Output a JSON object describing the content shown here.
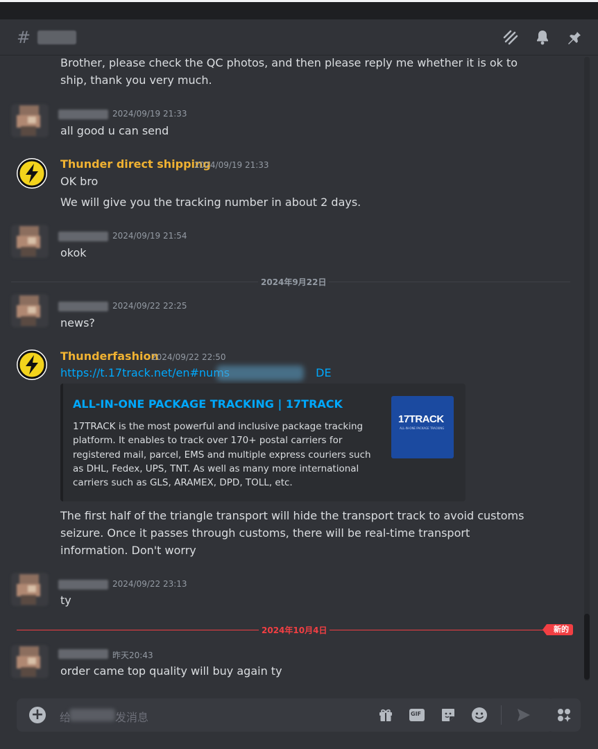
{
  "header": {
    "channel_icon": "hash-icon",
    "icons": [
      "threads-icon",
      "bell-icon",
      "pin-icon"
    ]
  },
  "messages": [
    {
      "text": "Brother, please check the QC photos, and then please reply me whether it is ok to ship, thank you very much."
    },
    {
      "timestamp": "2024/09/19 21:33",
      "text": "all good u can send"
    },
    {
      "username": "Thunder direct shipping",
      "timestamp": "2024/09/19 21:33",
      "lines": [
        "OK bro",
        "We will give you the tracking number in about 2 days."
      ]
    },
    {
      "timestamp": "2024/09/19 21:54",
      "text": "okok"
    },
    {
      "timestamp": "2024/09/22 22:25",
      "text": "news?"
    },
    {
      "username": "Thunderfashion",
      "timestamp": "2024/09/22 22:50",
      "link_start": "https://t.17track.net/en#nums",
      "link_end": "DE",
      "embed": {
        "title": "ALL-IN-ONE PACKAGE TRACKING | 17TRACK",
        "description": "17TRACK is the most powerful and inclusive package tracking platform. It enables to track over 170+ postal carriers for registered mail, parcel, EMS and multiple express couriers such as DHL, Fedex, UPS, TNT. As well as many more international carriers such as GLS, ARAMEX, DPD, TOLL, etc.",
        "thumb_logo": "17TRACK",
        "thumb_sub": "ALL-IN-ONE PACKAGE TRACKING"
      },
      "text": "The first half of the triangle transport will hide the transport track to avoid customs seizure. Once it passes through customs, there will be real-time transport information. Don't worry"
    },
    {
      "timestamp": "2024/09/22 23:13",
      "text": "ty"
    },
    {
      "timestamp": "昨天20:43",
      "text": "order came top quality will buy again ty"
    }
  ],
  "dividers": {
    "date1": "2024年9月22日",
    "date2": "2024年10月4日",
    "new_badge": "新的"
  },
  "composer": {
    "placeholder_start": "给",
    "placeholder_end": "发消息",
    "icons": [
      "add-icon",
      "gift-icon",
      "gif-icon",
      "sticker-icon",
      "emoji-icon",
      "send-icon",
      "apps-icon"
    ],
    "gif_label": "GIF"
  },
  "colors": {
    "background": "#313338",
    "username": "#f0b232",
    "link": "#00a8fc",
    "new_divider": "#f23f43"
  }
}
